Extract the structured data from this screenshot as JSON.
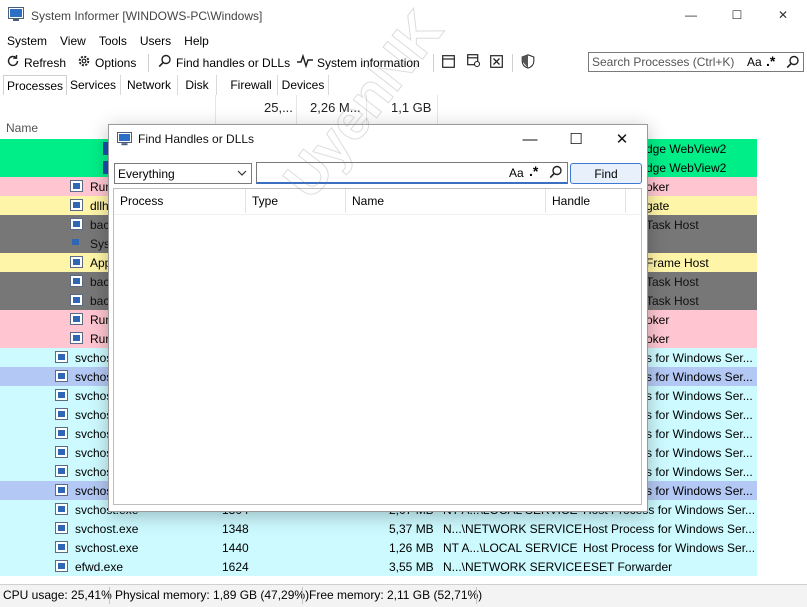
{
  "window": {
    "title": "System Informer [WINDOWS-PC\\Windows]",
    "controls": {
      "minimize": "—",
      "maximize": "☐",
      "close": "✕"
    }
  },
  "menu": [
    "System",
    "View",
    "Tools",
    "Users",
    "Help"
  ],
  "toolbar": {
    "refresh": "Refresh",
    "options": "Options",
    "find_handles": "Find handles or DLLs",
    "system_information": "System information",
    "search_placeholder": "Search Processes (Ctrl+K)",
    "search_case": "Aa",
    "search_regex": ".*"
  },
  "tabs": [
    "Processes",
    "Services",
    "Network",
    "Disk",
    "Firewall",
    "Devices"
  ],
  "header": {
    "summary_cpu": "25,...",
    "summary_private": "2,26 M...",
    "summary_memory": "1,1 GB",
    "name_column": "Name"
  },
  "rows": [
    {
      "name": "",
      "pid": "",
      "mem": "",
      "user": "",
      "desc": "dge WebView2",
      "color": "#00ee88"
    },
    {
      "name": "",
      "pid": "",
      "mem": "",
      "user": "",
      "desc": "dge WebView2",
      "color": "#00ee88"
    },
    {
      "name": "Run",
      "pid": "",
      "mem": "",
      "user": "",
      "desc": "oker",
      "color": "#ffc6d1"
    },
    {
      "name": "dllh",
      "pid": "",
      "mem": "",
      "user": "",
      "desc": "gate",
      "color": "#fff5a8"
    },
    {
      "name": "bac",
      "pid": "",
      "mem": "",
      "user": "",
      "desc": "Task Host",
      "color": "#777777"
    },
    {
      "name": "Sys",
      "pid": "",
      "mem": "",
      "user": "",
      "desc": "",
      "color": "#777777"
    },
    {
      "name": "App",
      "pid": "",
      "mem": "",
      "user": "",
      "desc": "Frame Host",
      "color": "#fff5a8"
    },
    {
      "name": "bac",
      "pid": "",
      "mem": "",
      "user": "",
      "desc": "Task Host",
      "color": "#777777"
    },
    {
      "name": "bac",
      "pid": "",
      "mem": "",
      "user": "",
      "desc": "Task Host",
      "color": "#777777"
    },
    {
      "name": "Run",
      "pid": "",
      "mem": "",
      "user": "",
      "desc": "oker",
      "color": "#ffc6d1"
    },
    {
      "name": "Run",
      "pid": "",
      "mem": "",
      "user": "",
      "desc": "oker",
      "color": "#ffc6d1"
    },
    {
      "name": "svchost.exe",
      "pid": "",
      "mem": "",
      "user": "",
      "desc": "s for Windows Ser...",
      "color": "#ccfaff"
    },
    {
      "name": "svchos",
      "pid": "",
      "mem": "",
      "user": "",
      "desc": "s for Windows Ser...",
      "color": "#b3c8f4"
    },
    {
      "name": "svchos",
      "pid": "",
      "mem": "",
      "user": "",
      "desc": "s for Windows Ser...",
      "color": "#ccfaff"
    },
    {
      "name": "svchos",
      "pid": "",
      "mem": "",
      "user": "",
      "desc": "s for Windows Ser...",
      "color": "#ccfaff"
    },
    {
      "name": "svchos",
      "pid": "",
      "mem": "",
      "user": "",
      "desc": "s for Windows Ser...",
      "color": "#ccfaff"
    },
    {
      "name": "svchos",
      "pid": "",
      "mem": "",
      "user": "",
      "desc": "s for Windows Ser...",
      "color": "#ccfaff"
    },
    {
      "name": "svchos",
      "pid": "",
      "mem": "",
      "user": "",
      "desc": "s for Windows Ser...",
      "color": "#ccfaff"
    },
    {
      "name": "svchos",
      "pid": "",
      "mem": "",
      "user": "",
      "desc": "s for Windows Ser...",
      "color": "#b3c8f4"
    },
    {
      "name": "svchost.exe",
      "pid": "1304",
      "mem": "2,07 MB",
      "user": "NT A...\\LOCAL SERVICE",
      "desc": "Host Process for Windows Ser...",
      "color": "#ccfaff"
    },
    {
      "name": "svchost.exe",
      "pid": "1348",
      "mem": "5,37 MB",
      "user": "N...\\NETWORK SERVICE",
      "desc": "Host Process for Windows Ser...",
      "color": "#ccfaff"
    },
    {
      "name": "svchost.exe",
      "pid": "1440",
      "mem": "1,26 MB",
      "user": "NT A...\\LOCAL SERVICE",
      "desc": "Host Process for Windows Ser...",
      "color": "#ccfaff"
    },
    {
      "name": "efwd.exe",
      "pid": "1624",
      "mem": "3,55 MB",
      "user": "N...\\NETWORK SERVICE",
      "desc": "ESET Forwarder",
      "color": "#ccfaff"
    }
  ],
  "status": {
    "cpu": "CPU usage: 25,41%",
    "physical": "Physical memory: 1,89 GB (47,29%)",
    "free": "Free memory: 2,11 GB (52,71%)"
  },
  "dialog": {
    "title": "Find Handles or DLLs",
    "scope_value": "Everything",
    "filter_value": "",
    "case_toggle": "Aa",
    "regex_toggle": ".*",
    "find_button": "Find",
    "columns": [
      "Process",
      "Type",
      "Name",
      "Handle"
    ],
    "controls": {
      "minimize": "—",
      "maximize": "☐",
      "close": "✕"
    }
  },
  "watermark": "UyenNK"
}
